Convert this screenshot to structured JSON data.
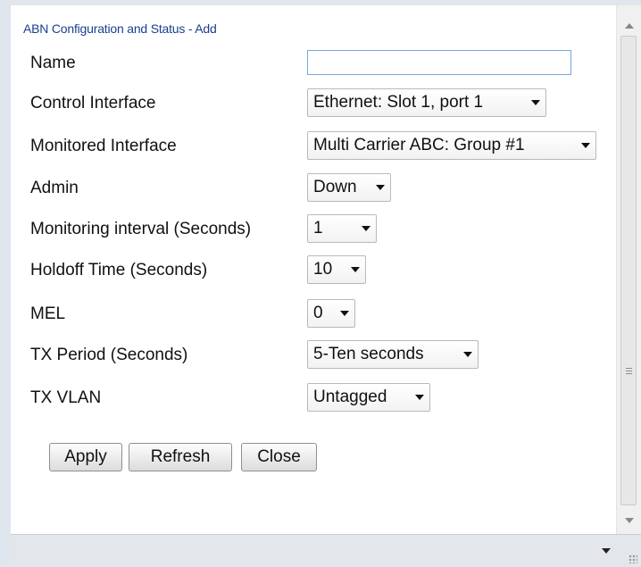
{
  "dialog": {
    "title": "ABN Configuration and Status - Add"
  },
  "form": {
    "name": {
      "label": "Name",
      "value": ""
    },
    "control_interface": {
      "label": "Control Interface",
      "value": "Ethernet: Slot 1, port 1"
    },
    "monitored_interface": {
      "label": "Monitored Interface",
      "value": "Multi Carrier ABC: Group #1"
    },
    "admin": {
      "label": "Admin",
      "value": "Down"
    },
    "monitoring_interval": {
      "label": "Monitoring interval (Seconds)",
      "value": "1"
    },
    "holdoff_time": {
      "label": "Holdoff Time (Seconds)",
      "value": "10"
    },
    "mel": {
      "label": "MEL",
      "value": "0"
    },
    "tx_period": {
      "label": "TX Period (Seconds)",
      "value": "5-Ten seconds"
    },
    "tx_vlan": {
      "label": "TX VLAN",
      "value": "Untagged"
    }
  },
  "buttons": {
    "apply": "Apply",
    "refresh": "Refresh",
    "close": "Close"
  },
  "icons": {
    "scroll_up": "chevron-up-icon",
    "scroll_down": "chevron-down-icon",
    "status_menu": "caret-down-icon",
    "resize": "resize-grip-icon"
  }
}
